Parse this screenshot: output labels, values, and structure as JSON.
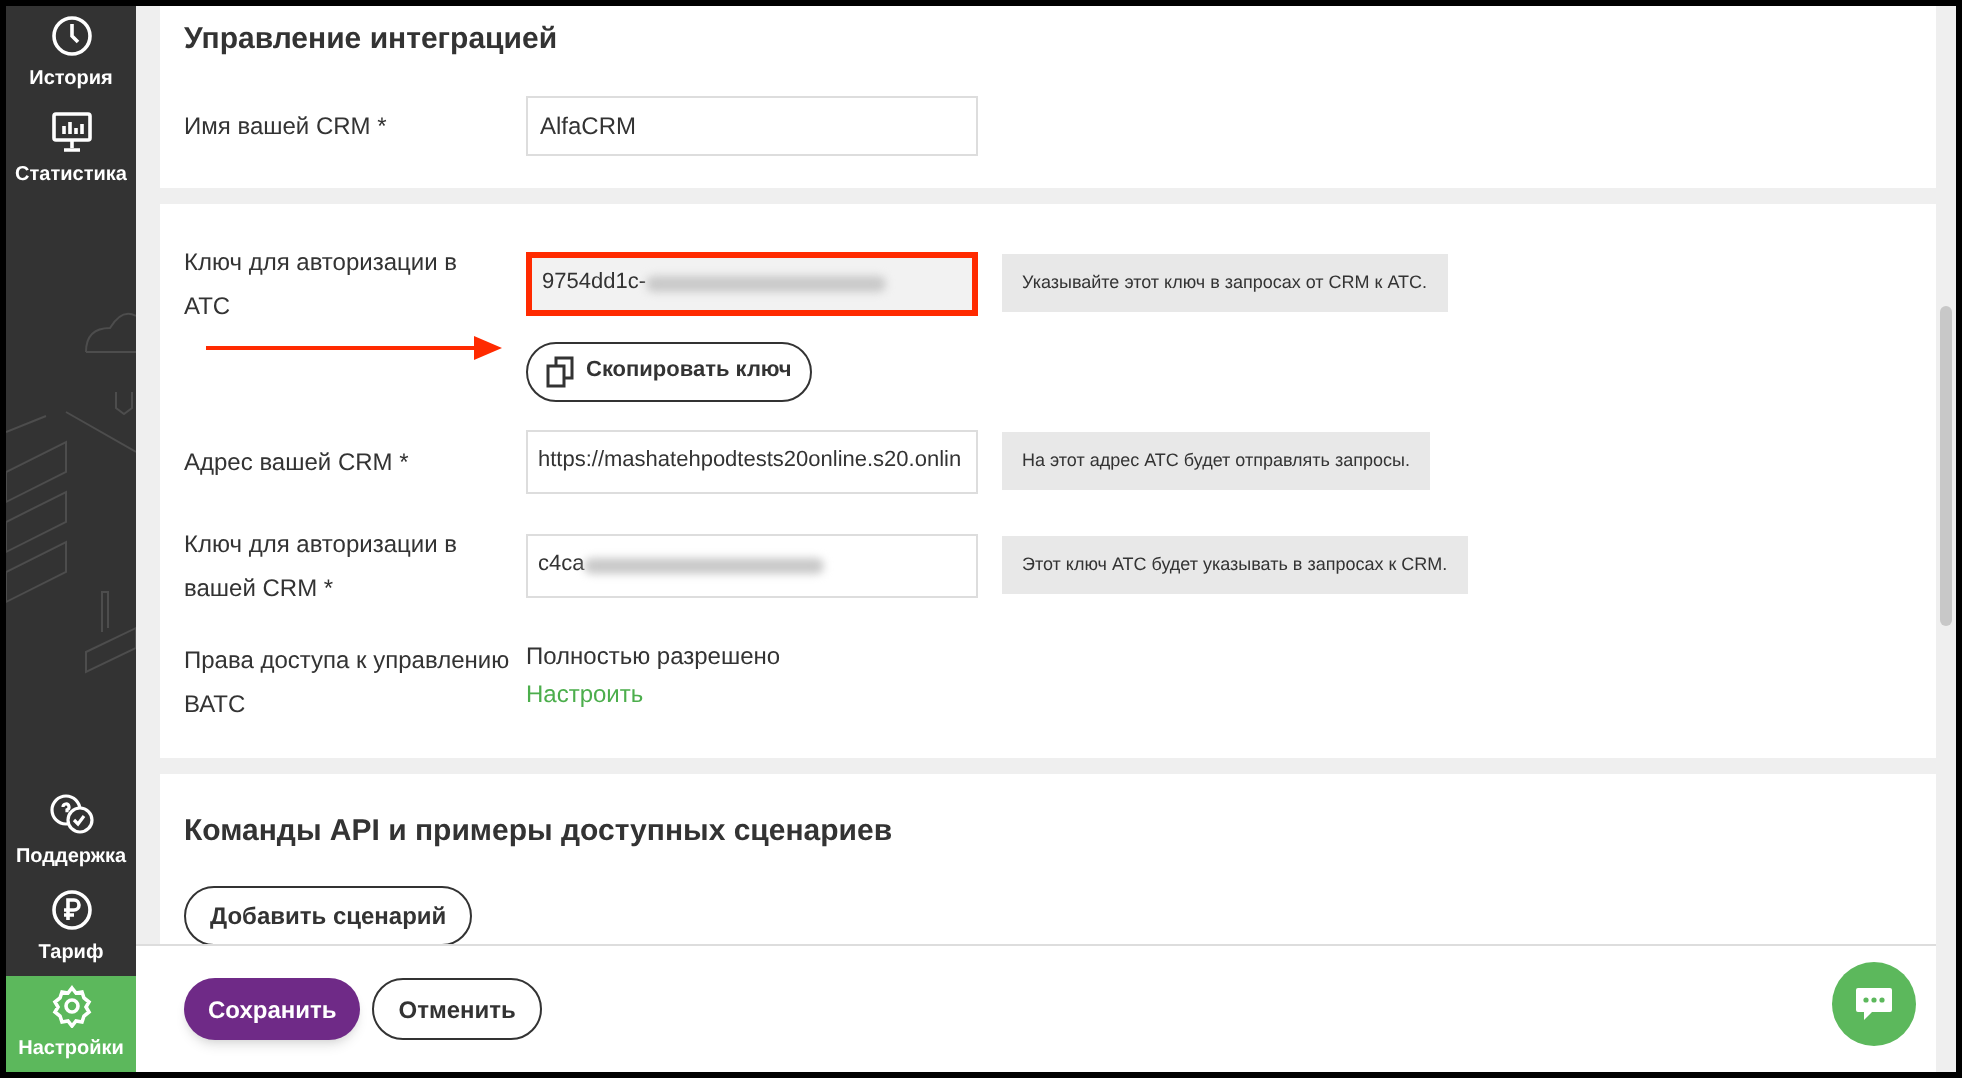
{
  "sidebar": {
    "top_items": [
      {
        "kind": "clock",
        "label": "История",
        "selected": false
      },
      {
        "kind": "chart",
        "label": "Статистика",
        "selected": false
      }
    ],
    "bottom_items": [
      {
        "kind": "support",
        "label": "Поддержка",
        "selected": false
      },
      {
        "kind": "ruble",
        "label": "Тариф",
        "selected": false
      },
      {
        "kind": "gear",
        "label": "Настройки",
        "selected": true
      }
    ]
  },
  "integration": {
    "title": "Управление интеграцией",
    "crm_name": {
      "label": "Имя вашей CRM *",
      "value": "AlfaCRM"
    }
  },
  "keys": {
    "fields": [
      {
        "label": "Ключ для авторизации в АТС",
        "value": "9754dd1c-",
        "redacted": true,
        "highlighted": true,
        "hint": "Указывайте этот ключ в запросах от CRM к АТС.",
        "copy_button": "Скопировать ключ"
      },
      {
        "label": "Адрес вашей CRM *",
        "value": "https://mashatehpodtests20online.s20.onlin",
        "highlighted": false,
        "hint": "На этот адрес АТС будет отправлять запросы."
      },
      {
        "label": "Ключ для авторизации в вашей CRM *",
        "value": "c4ca",
        "redacted": true,
        "highlighted": false,
        "hint": "Этот ключ АТС будет указывать в запросах к CRM."
      }
    ],
    "access": {
      "label": "Права доступа к управлению ВАТС",
      "value": "Полностью разрешено",
      "link": "Настроить"
    }
  },
  "api": {
    "title": "Команды API и примеры доступных сценариев",
    "add_button": "Добавить сценарий"
  },
  "footer": {
    "save": "Сохранить",
    "cancel": "Отменить"
  }
}
